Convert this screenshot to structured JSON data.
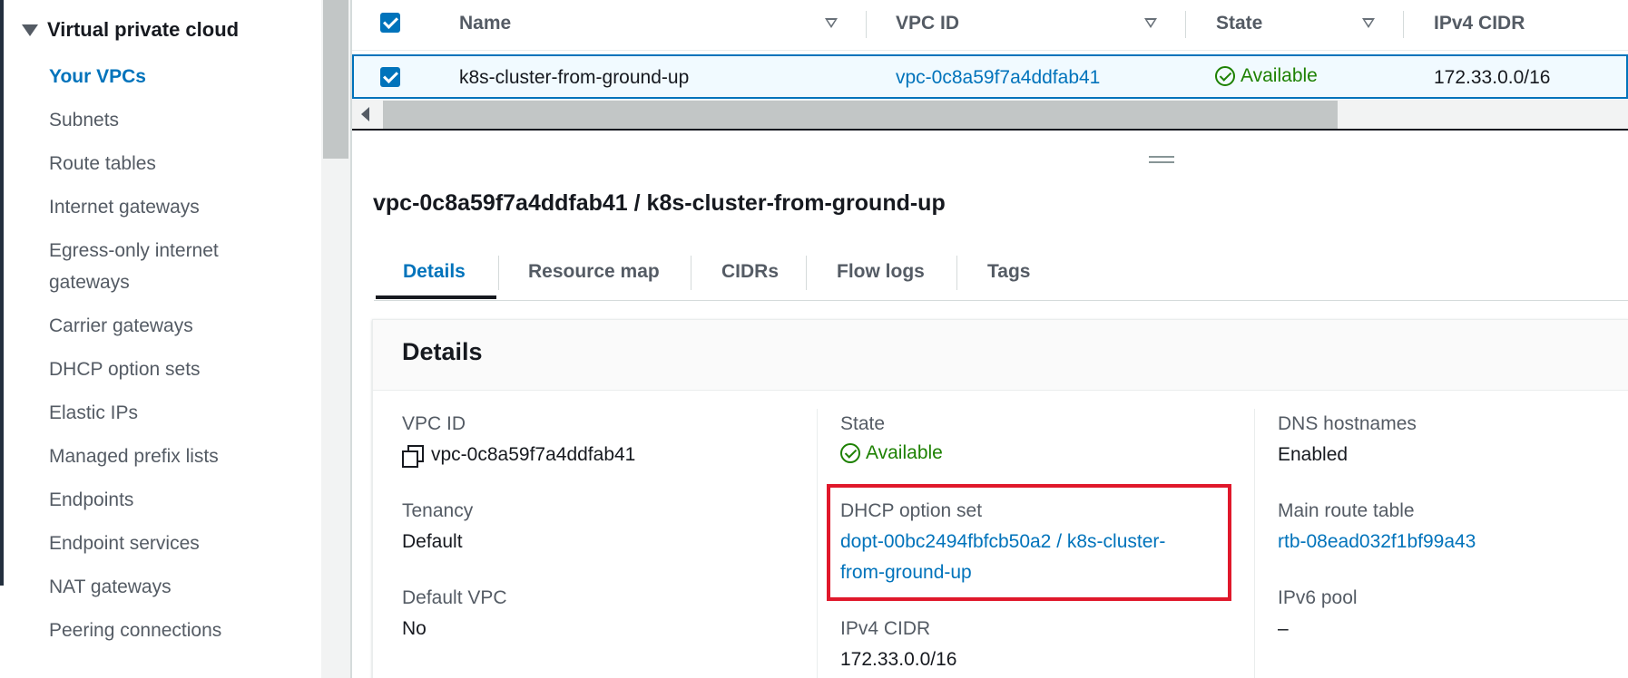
{
  "sidebar": {
    "section_title": "Virtual private cloud",
    "items": [
      {
        "label": "Your VPCs"
      },
      {
        "label": "Subnets"
      },
      {
        "label": "Route tables"
      },
      {
        "label": "Internet gateways"
      },
      {
        "label": "Egress-only internet gateways"
      },
      {
        "label": "Carrier gateways"
      },
      {
        "label": "DHCP option sets"
      },
      {
        "label": "Elastic IPs"
      },
      {
        "label": "Managed prefix lists"
      },
      {
        "label": "Endpoints"
      },
      {
        "label": "Endpoint services"
      },
      {
        "label": "NAT gateways"
      },
      {
        "label": "Peering connections"
      }
    ]
  },
  "table": {
    "columns": [
      "Name",
      "VPC ID",
      "State",
      "IPv4 CIDR"
    ],
    "row": {
      "name": "k8s-cluster-from-ground-up",
      "vpc_id": "vpc-0c8a59f7a4ddfab41",
      "state": "Available",
      "ipv4_cidr": "172.33.0.0/16"
    }
  },
  "page_title": "vpc-0c8a59f7a4ddfab41 / k8s-cluster-from-ground-up",
  "tabs": [
    "Details",
    "Resource map",
    "CIDRs",
    "Flow logs",
    "Tags"
  ],
  "details": {
    "title": "Details",
    "vpc_id_label": "VPC ID",
    "vpc_id_value": "vpc-0c8a59f7a4ddfab41",
    "tenancy_label": "Tenancy",
    "tenancy_value": "Default",
    "default_vpc_label": "Default VPC",
    "default_vpc_value": "No",
    "state_label": "State",
    "state_value": "Available",
    "dhcp_label": "DHCP option set",
    "dhcp_value_line1": "dopt-00bc2494fbfcb50a2 / k8s-cluster-",
    "dhcp_value_line2": "from-ground-up",
    "ipv4_cidr_label": "IPv4 CIDR",
    "ipv4_cidr_value": "172.33.0.0/16",
    "dns_hostnames_label": "DNS hostnames",
    "dns_hostnames_value": "Enabled",
    "main_route_table_label": "Main route table",
    "main_route_table_value": "rtb-08ead032f1bf99a43",
    "ipv6_pool_label": "IPv6 pool",
    "ipv6_pool_value": "–"
  },
  "colors": {
    "link": "#0073bb",
    "success": "#1d8102",
    "highlight": "#e0182b"
  }
}
